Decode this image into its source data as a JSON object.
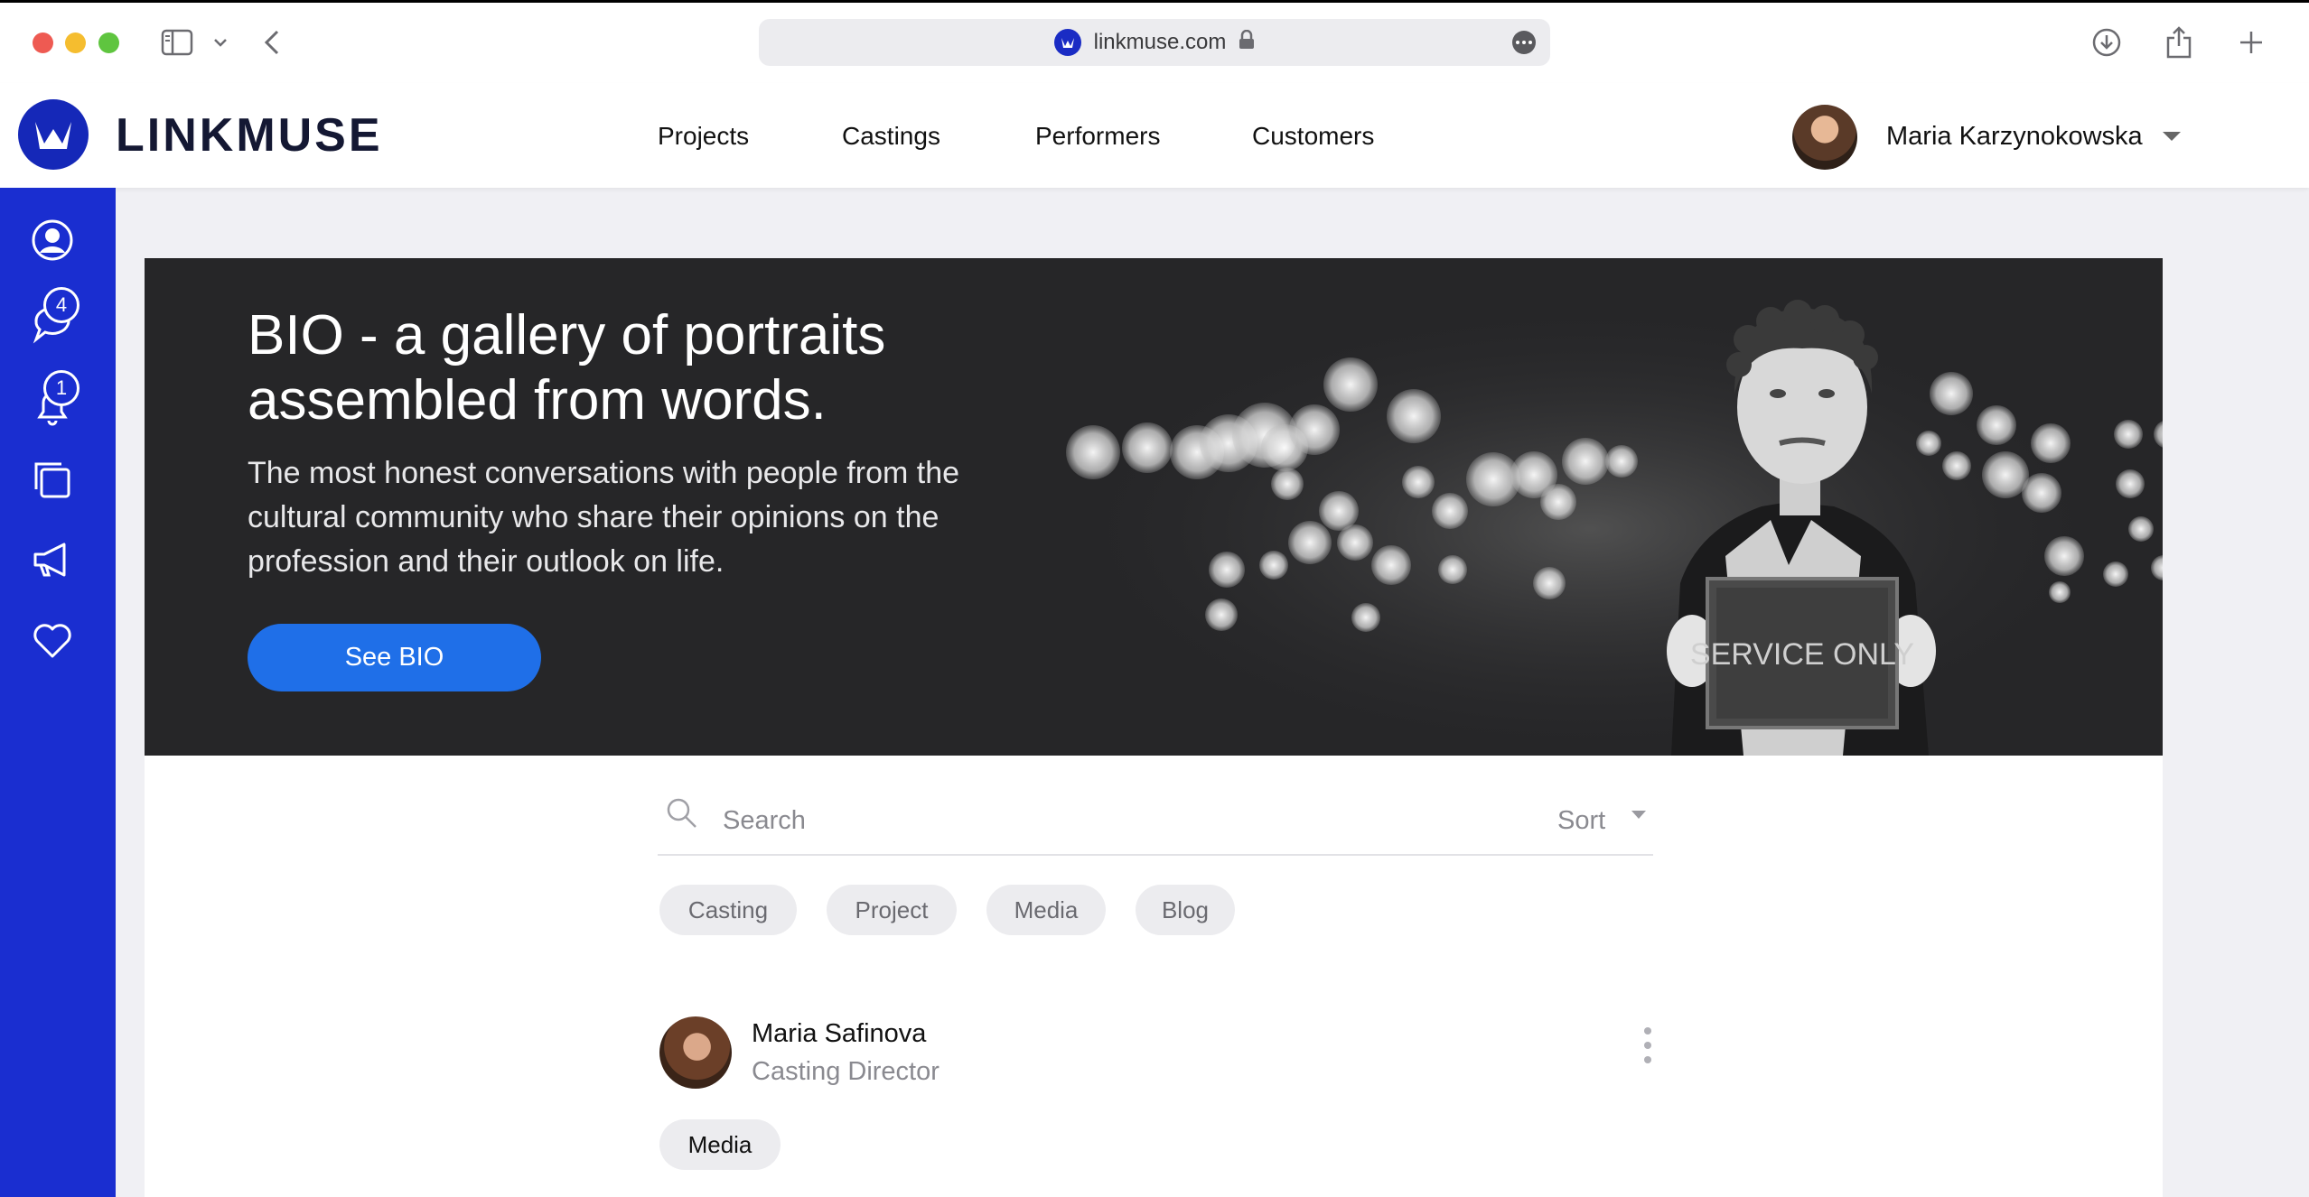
{
  "browser": {
    "url": "linkmuse.com",
    "icons": [
      "sidebar-toggle-icon",
      "chevron-down-icon",
      "back-icon",
      "lock-icon",
      "more-icon",
      "download-icon",
      "share-icon",
      "new-tab-icon"
    ]
  },
  "header": {
    "brand": "LINKMUSE",
    "nav": [
      "Projects",
      "Castings",
      "Performers",
      "Customers"
    ],
    "user_name": "Maria Karzynokowska"
  },
  "sidebar": {
    "accent": "#1a2ed0",
    "items": [
      {
        "icon": "profile-icon"
      },
      {
        "icon": "chat-icon",
        "badge": "4"
      },
      {
        "icon": "bell-icon",
        "badge": "1"
      },
      {
        "icon": "copy-icon"
      },
      {
        "icon": "megaphone-icon"
      },
      {
        "icon": "heart-icon"
      }
    ]
  },
  "hero": {
    "title": "BIO - a gallery of portraits assembled from words.",
    "description": "The most honest conversations with people from the cultural community who share their opinions on the profession and their outlook on life.",
    "button": "See BIO",
    "sign_text": "SERVICE ONLY",
    "button_color": "#1f6fe8"
  },
  "search": {
    "placeholder": "Search",
    "sort_label": "Sort"
  },
  "filters": [
    "Casting",
    "Project",
    "Media",
    "Blog"
  ],
  "feed": [
    {
      "name": "Maria Safinova",
      "role": "Casting Director",
      "tag": "Media"
    }
  ]
}
